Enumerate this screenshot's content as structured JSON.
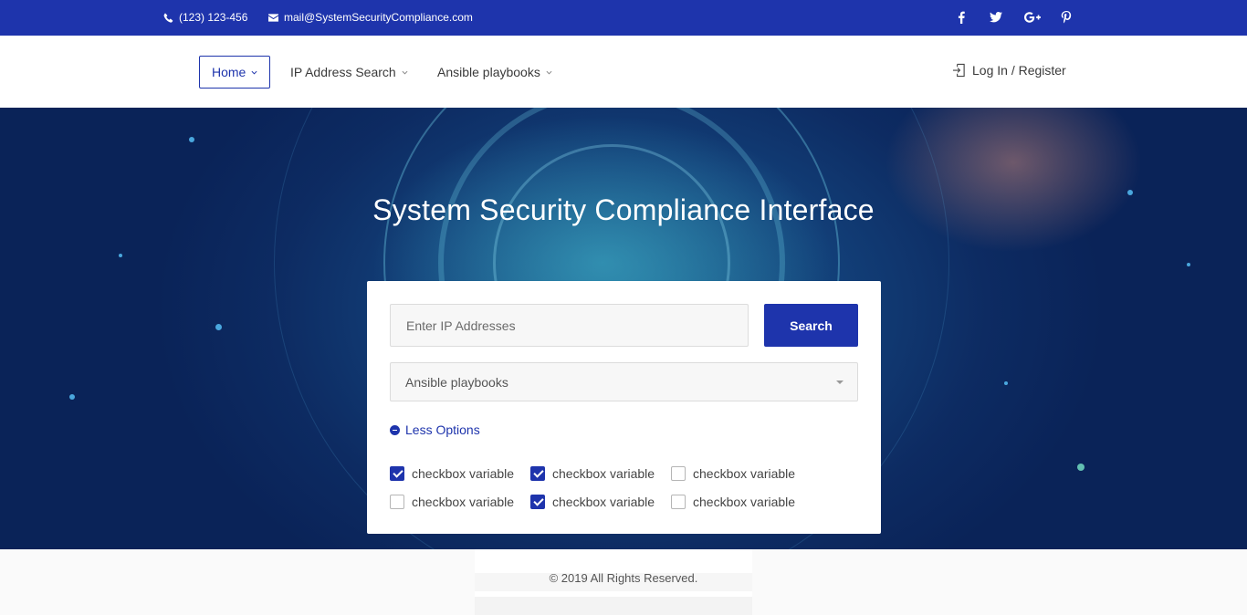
{
  "topbar": {
    "phone": "(123) 123-456",
    "email": "mail@SystemSecurityCompliance.com",
    "social": [
      "facebook-icon",
      "twitter-icon",
      "google-plus-icon",
      "pinterest-icon"
    ]
  },
  "nav": {
    "items": [
      {
        "label": "Home",
        "active": true
      },
      {
        "label": "IP Address Search",
        "active": false
      },
      {
        "label": "Ansible playbooks",
        "active": false
      }
    ],
    "login": "Log In / Register"
  },
  "hero": {
    "title": "System Security Compliance Interface"
  },
  "search": {
    "ip_placeholder": "Enter IP Addresses",
    "ip_value": "",
    "button": "Search",
    "playbook_selected": "Ansible playbooks",
    "less_options": "Less Options",
    "checkboxes": [
      {
        "label": "checkbox variable",
        "checked": true
      },
      {
        "label": "checkbox variable",
        "checked": true
      },
      {
        "label": "checkbox variable",
        "checked": false
      },
      {
        "label": "checkbox variable",
        "checked": false
      },
      {
        "label": "checkbox variable",
        "checked": true
      },
      {
        "label": "checkbox variable",
        "checked": false
      }
    ]
  },
  "footer": {
    "copyright": "© 2019  All Rights Reserved."
  },
  "colors": {
    "brand": "#1e34ac",
    "hero_dark": "#0d2b62",
    "hero_glow": "#46bed2"
  }
}
